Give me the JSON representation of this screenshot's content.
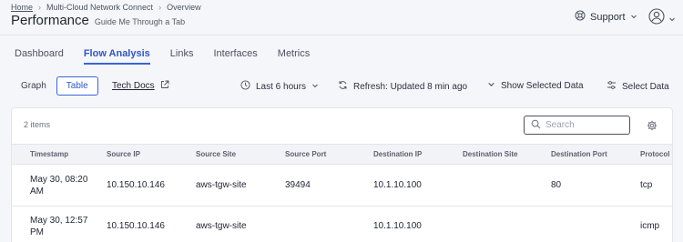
{
  "breadcrumb": {
    "home": "Home",
    "section": "Multi-Cloud Network Connect",
    "current": "Overview"
  },
  "page": {
    "title": "Performance",
    "guide_link": "Guide Me Through a Tab"
  },
  "header": {
    "support_label": "Support"
  },
  "tabs": [
    {
      "label": "Dashboard",
      "active": false
    },
    {
      "label": "Flow Analysis",
      "active": true
    },
    {
      "label": "Links",
      "active": false
    },
    {
      "label": "Interfaces",
      "active": false
    },
    {
      "label": "Metrics",
      "active": false
    }
  ],
  "toolbar": {
    "view_toggle": [
      {
        "label": "Graph",
        "active": false
      },
      {
        "label": "Table",
        "active": true
      }
    ],
    "tech_docs": "Tech Docs",
    "time_range": "Last 6 hours",
    "refresh": "Refresh: Updated 8 min ago",
    "show_selected": "Show Selected Data",
    "select_data": "Select Data"
  },
  "table": {
    "item_count": "2 items",
    "search_placeholder": "Search",
    "columns": [
      "Timestamp",
      "Source IP",
      "Source Site",
      "Source Port",
      "Destination IP",
      "Destination Site",
      "Destination Port",
      "Protocol"
    ],
    "rows": [
      {
        "timestamp": "May 30, 08:20 AM",
        "source_ip": "10.150.10.146",
        "source_site": "aws-tgw-site",
        "source_port": "39494",
        "destination_ip": "10.1.10.100",
        "destination_site": "",
        "destination_port": "80",
        "protocol": "tcp"
      },
      {
        "timestamp": "May 30, 12:57 PM",
        "source_ip": "10.150.10.146",
        "source_site": "aws-tgw-site",
        "source_port": "",
        "destination_ip": "10.1.10.100",
        "destination_site": "",
        "destination_port": "",
        "protocol": "icmp"
      }
    ]
  },
  "colors": {
    "accent": "#3a63d9",
    "background": "#f5f6f9",
    "card": "#ffffff"
  }
}
